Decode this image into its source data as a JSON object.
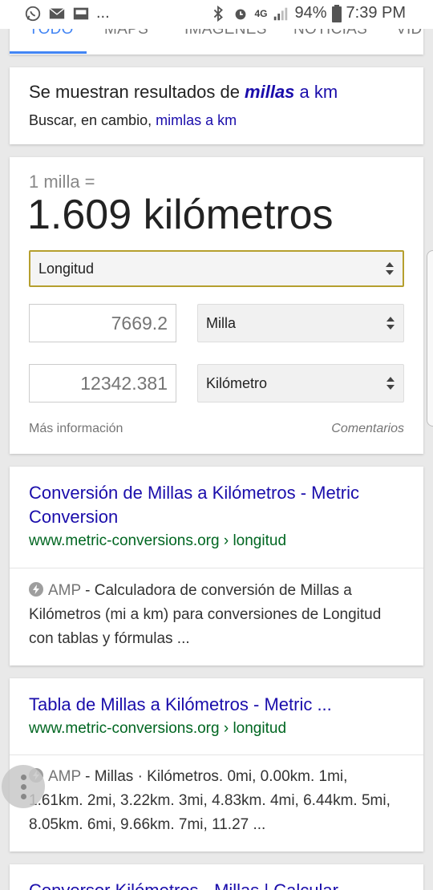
{
  "status_bar": {
    "left_more": "...",
    "network": "4G",
    "battery": "94%",
    "time": "7:39 PM"
  },
  "tabs": [
    {
      "label": "TODO",
      "active": true
    },
    {
      "label": "MAPS",
      "active": false
    },
    {
      "label": "IMÁGENES",
      "active": false
    },
    {
      "label": "NOTICIAS",
      "active": false
    },
    {
      "label": "VID",
      "active": false
    }
  ],
  "showing_card": {
    "prefix": "Se muestran resultados de ",
    "query_bold": "millas",
    "query_rest": " a km",
    "instead_prefix": "Buscar, en cambio, ",
    "instead_link": "mimlas a km"
  },
  "converter": {
    "equation": "1 milla =",
    "result": "1.609 kilómetros",
    "category": "Longitud",
    "from_value": "7669.2",
    "from_unit": "Milla",
    "to_value": "12342.381",
    "to_unit": "Kilómetro",
    "more_info": "Más información",
    "comments": "Comentarios"
  },
  "results": [
    {
      "title": "Conversión de Millas a Kilómetros - Metric Conversion",
      "url": "www.metric-conversions.org › longitud",
      "amp": "AMP",
      "snippet": " - Calculadora de conversión de Millas a Kilómetros (mi a km) para conversiones de Longitud con tablas y fórmulas ..."
    },
    {
      "title": "Tabla de Millas a Kilómetros - Metric ...",
      "url": "www.metric-conversions.org › longitud",
      "amp": "AMP",
      "snippet": " - Millas · Kilómetros. 0mi, 0.00km. 1mi, 1.61km. 2mi, 3.22km. 3mi, 4.83km. 4mi, 6.44km. 5mi, 8.05km. 6mi, 9.66km. 7mi, 11.27  ..."
    },
    {
      "title": "Conversor Kilómetros - Millas | Calcular"
    }
  ],
  "colors": {
    "link": "#1a0dab",
    "url_green": "#006621",
    "accent_blue": "#4285f4",
    "focus_border": "#b59f2e"
  }
}
